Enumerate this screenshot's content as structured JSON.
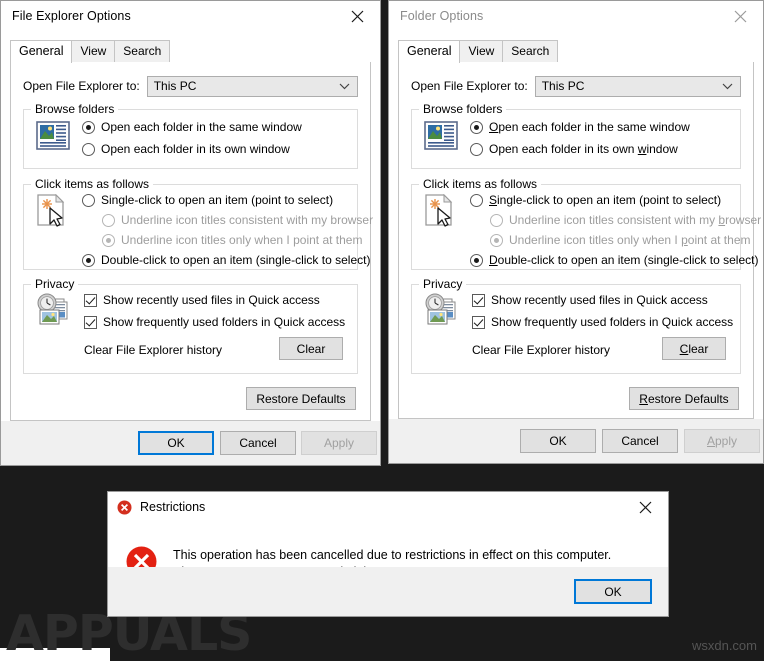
{
  "desktop": {
    "background_color": "#1b1b1b"
  },
  "windows": [
    {
      "id": "file-explorer-options",
      "title": "File Explorer Options",
      "active": true,
      "close_label": "Close",
      "tabs": [
        {
          "label": "General",
          "selected": true
        },
        {
          "label": "View",
          "selected": false
        },
        {
          "label": "Search",
          "selected": false
        }
      ],
      "open_to": {
        "label": "Open File Explorer to:",
        "value": "This PC",
        "chevron_icon": "chevron-down-icon"
      },
      "browse_folders": {
        "legend": "Browse folders",
        "icon": "folder-browse-icon",
        "options": [
          {
            "label": "Open each folder in the same window",
            "selected": true
          },
          {
            "label": "Open each folder in its own window",
            "selected": false
          }
        ]
      },
      "click_items": {
        "legend": "Click items as follows",
        "icon": "click-item-icon",
        "options": [
          {
            "label": "Single-click to open an item (point to select)",
            "selected": false,
            "disabled": false,
            "indent": false
          },
          {
            "label": "Underline icon titles consistent with my browser",
            "selected": false,
            "disabled": true,
            "indent": true
          },
          {
            "label": "Underline icon titles only when I point at them",
            "selected": true,
            "disabled": true,
            "indent": true
          },
          {
            "label": "Double-click to open an item (single-click to select)",
            "selected": true,
            "disabled": false,
            "indent": false
          }
        ]
      },
      "privacy": {
        "legend": "Privacy",
        "icon": "recent-history-icon",
        "checkboxes": [
          {
            "label": "Show recently used files in Quick access",
            "checked": true
          },
          {
            "label": "Show frequently used folders in Quick access",
            "checked": true
          }
        ],
        "clear_history_label": "Clear File Explorer history",
        "clear_button": "Clear"
      },
      "restore_defaults_button": "Restore Defaults",
      "footer_buttons": [
        {
          "label": "OK",
          "focused": true,
          "disabled": false
        },
        {
          "label": "Cancel",
          "focused": false,
          "disabled": false
        },
        {
          "label": "Apply",
          "focused": false,
          "disabled": true
        }
      ]
    },
    {
      "id": "folder-options",
      "title": "Folder Options",
      "active": false,
      "close_label": "Close",
      "tabs": [
        {
          "label": "General",
          "selected": true
        },
        {
          "label": "View",
          "selected": false
        },
        {
          "label": "Search",
          "selected": false
        }
      ],
      "open_to": {
        "label": "Open File Explorer to:",
        "value": "This PC",
        "chevron_icon": "chevron-down-icon"
      },
      "browse_folders": {
        "legend": "Browse folders",
        "icon": "folder-browse-icon",
        "options": [
          {
            "label": "Open each folder in the same window",
            "selected": true
          },
          {
            "label": "Open each folder in its own window",
            "selected": false
          }
        ]
      },
      "click_items": {
        "legend": "Click items as follows",
        "icon": "click-item-icon",
        "options": [
          {
            "label": "Single-click to open an item (point to select)",
            "selected": false,
            "disabled": false,
            "indent": false
          },
          {
            "label": "Underline icon titles consistent with my browser",
            "selected": false,
            "disabled": true,
            "indent": true
          },
          {
            "label": "Underline icon titles only when I point at them",
            "selected": true,
            "disabled": true,
            "indent": true
          },
          {
            "label": "Double-click to open an item (single-click to select)",
            "selected": true,
            "disabled": false,
            "indent": false
          }
        ]
      },
      "privacy": {
        "legend": "Privacy",
        "icon": "recent-history-icon",
        "checkboxes": [
          {
            "label": "Show recently used files in Quick access",
            "checked": true
          },
          {
            "label": "Show frequently used folders in Quick access",
            "checked": true
          }
        ],
        "clear_history_label": "Clear File Explorer history",
        "clear_button": "Clear"
      },
      "restore_defaults_button": "Restore Defaults",
      "footer_buttons": [
        {
          "label": "OK",
          "focused": false,
          "disabled": false
        },
        {
          "label": "Cancel",
          "focused": false,
          "disabled": false
        },
        {
          "label": "Apply",
          "focused": false,
          "disabled": true
        }
      ]
    }
  ],
  "dialog": {
    "id": "restrictions-dialog",
    "title": "Restrictions",
    "title_icon": "error-icon",
    "body_icon": "error-icon",
    "message": "This operation has been cancelled due to restrictions in effect on this computer. Please contact your system administrator.",
    "ok_button": "OK",
    "close_label": "Close"
  },
  "watermarks": {
    "brand": "APPUALS",
    "site": "wsxdn.com"
  },
  "colors": {
    "accent": "#0078d7",
    "error": "#e81123",
    "window_face": "#f0f0f0",
    "window_content": "#ffffff",
    "desktop": "#1b1b1b"
  }
}
